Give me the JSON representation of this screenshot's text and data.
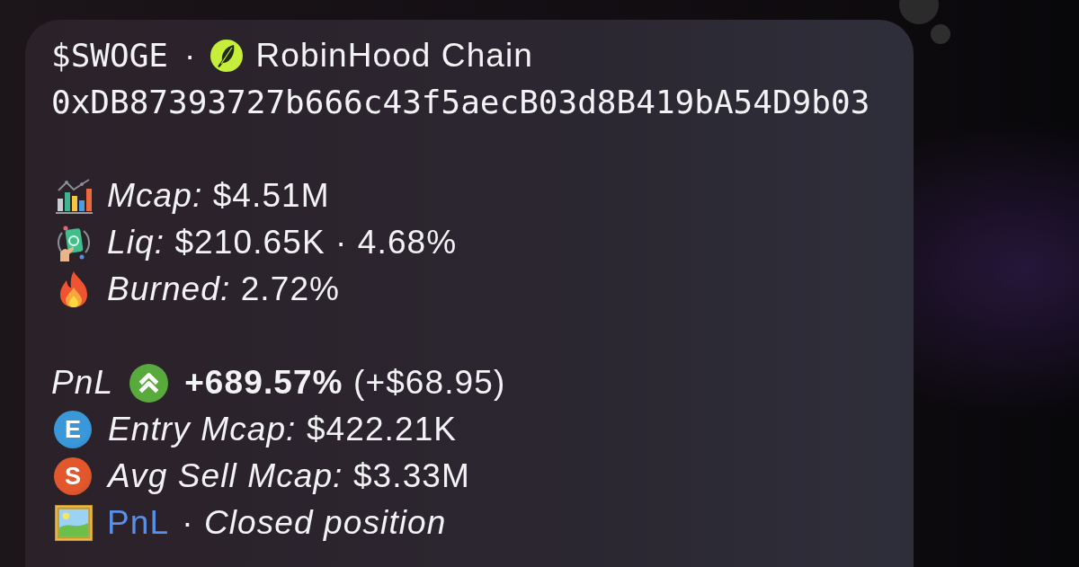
{
  "message": {
    "token": {
      "symbol": "$SWOGE",
      "separator": "·",
      "chain": "RobinHood Chain"
    },
    "address": "0xDB87393727b666c43f5aecB03d8B419bA54D9b03",
    "stats": [
      {
        "kind": "mcap",
        "text": "*Mcap:* $4.51M"
      },
      {
        "kind": "liquidity",
        "text": "*Liq:* $210.65K · 4.68%"
      },
      {
        "kind": "burned",
        "text": "*Burned:* 2.72%"
      }
    ],
    "pnl": {
      "label": "PnL",
      "result": "**+689.57%** (+$68.95)"
    },
    "trades": [
      {
        "kind": "entry",
        "letter": "E",
        "text": "*Entry Mcap:* $422.21K"
      },
      {
        "kind": "avg_sell",
        "letter": "S",
        "text": "*Avg Sell Mcap:* $3.33M"
      }
    ],
    "footer": {
      "link": "PnL",
      "note": "· *Closed position*"
    }
  }
}
